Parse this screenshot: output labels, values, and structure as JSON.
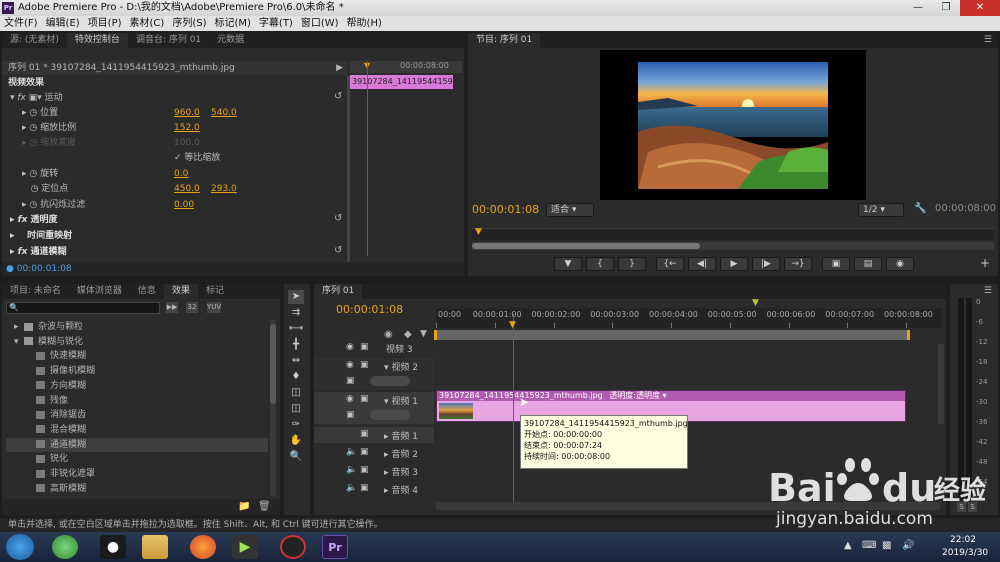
{
  "window": {
    "title": "Adobe Premiere Pro - D:\\我的文档\\Adobe\\Premiere Pro\\6.0\\未命名 *"
  },
  "menu": [
    "文件(F)",
    "编辑(E)",
    "项目(P)",
    "素材(C)",
    "序列(S)",
    "标记(M)",
    "字幕(T)",
    "窗口(W)",
    "帮助(H)"
  ],
  "effect_controls": {
    "tabs": [
      "源: (无素材)",
      "特效控制台",
      "调音台: 序列 01",
      "元数据"
    ],
    "clip_header": "序列 01 * 39107284_1411954415923_mthumb.jpg",
    "clip_label": "39107284_1411954415923_mthumb.jpg",
    "section": "视频效果",
    "motion": "运动",
    "position_label": "位置",
    "position_x": "960.0",
    "position_y": "540.0",
    "scale_label": "缩放比例",
    "scale": "152.0",
    "scale_width_label": "缩放宽度",
    "scale_width": "100.0",
    "uniform_scale": "等比缩放",
    "rotation_label": "旋转",
    "rotation": "0.0",
    "anchor_label": "定位点",
    "anchor_x": "450.0",
    "anchor_y": "293.0",
    "antiflicker_label": "抗闪烁过滤",
    "antiflicker": "0.00",
    "opacity": "透明度",
    "time_remap": "时间重映射",
    "channel_blur": "通道模糊",
    "timecode": "00:00:01:08"
  },
  "program": {
    "tab": "节目: 序列 01",
    "timecode": "00:00:01:08",
    "fit": "适合",
    "resolution": "1/2",
    "duration": "00:00:08:00"
  },
  "project": {
    "tabs": [
      "项目: 未命名",
      "媒体浏览器",
      "信息",
      "效果",
      "标记"
    ],
    "items": [
      {
        "label": "杂波与颗粒",
        "type": "folder"
      },
      {
        "label": "模糊与锐化",
        "type": "folder-open"
      },
      {
        "label": "快速模糊",
        "type": "effect"
      },
      {
        "label": "摄像机模糊",
        "type": "effect"
      },
      {
        "label": "方向模糊",
        "type": "effect"
      },
      {
        "label": "残像",
        "type": "effect"
      },
      {
        "label": "消除锯齿",
        "type": "effect"
      },
      {
        "label": "混合模糊",
        "type": "effect"
      },
      {
        "label": "通道模糊",
        "type": "effect"
      },
      {
        "label": "锐化",
        "type": "effect"
      },
      {
        "label": "非锐化遮罩",
        "type": "effect"
      },
      {
        "label": "高斯模糊",
        "type": "effect"
      }
    ]
  },
  "timeline": {
    "tab": "序列 01",
    "timecode": "00:00:01:08",
    "ruler": [
      "00:00",
      "00:00:01:00",
      "00:00:02:00",
      "00:00:03:00",
      "00:00:04:00",
      "00:00:05:00",
      "00:00:06:00",
      "00:00:07:00",
      "00:00:08:00"
    ],
    "tracks": {
      "v3": "视频 3",
      "v2": "视频 2",
      "v1": "视频 1",
      "a1": "音频 1",
      "a2": "音频 2",
      "a3": "音频 3",
      "a4": "音频 4"
    },
    "clip_name": "39107284_1411954415923_mthumb.jpg",
    "clip_opacity": "透明度:透明度",
    "tooltip": {
      "name": "39107284_1411954415923_mthumb.jpg",
      "start": "开始点: 00:00:00:00",
      "end": "结束点: 00:00:07:24",
      "duration": "持续时间: 00:00:08:00"
    }
  },
  "meter": {
    "scale": [
      "0",
      "-6",
      "-12",
      "-18",
      "-24",
      "-30",
      "-36",
      "-42",
      "-48",
      "-54"
    ],
    "solo": [
      "S",
      "S"
    ]
  },
  "status": "单击并选择, 或在空白区域单击并拖拉为选取框。按住 Shift、Alt, 和 Ctrl 键可进行其它操作。",
  "taskbar": {
    "time": "22:02",
    "date": "2019/3/30"
  },
  "watermark": {
    "logo": "Bai du 经验",
    "url": "jingyan.baidu.com"
  }
}
